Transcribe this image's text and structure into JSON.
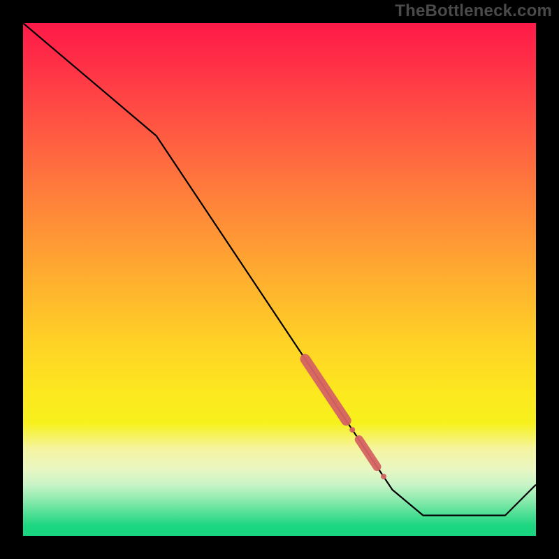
{
  "watermark": "TheBottleneck.com",
  "chart_data": {
    "type": "line",
    "title": "",
    "xlabel": "",
    "ylabel": "",
    "xlim": [
      0,
      100
    ],
    "ylim": [
      0,
      100
    ],
    "grid": false,
    "legend": false,
    "series": [
      {
        "name": "curve",
        "x": [
          0,
          26,
          72,
          78,
          94,
          100
        ],
        "y": [
          100,
          78,
          9,
          4,
          4,
          10
        ]
      }
    ],
    "markers": [
      {
        "name": "highlight-segment-upper",
        "shape": "thick-segment",
        "x0": 55,
        "y0": 34.5,
        "x1": 63,
        "y1": 22.5,
        "radius": 1.8
      },
      {
        "name": "highlight-dot-mid",
        "shape": "dot",
        "x": 64.2,
        "y": 20.7,
        "radius": 1.0
      },
      {
        "name": "highlight-segment-mid",
        "shape": "thick-segment",
        "x0": 65.5,
        "y0": 18.8,
        "x1": 69.0,
        "y1": 13.5,
        "radius": 1.5
      },
      {
        "name": "highlight-dot-lower",
        "shape": "dot",
        "x": 70.3,
        "y": 11.6,
        "radius": 1.0
      }
    ],
    "colors": {
      "line": "#000000",
      "marker": "#d56262",
      "gradient_top": "#ff1a49",
      "gradient_mid": "#ffd126",
      "gradient_bottom": "#17d47e",
      "frame": "#000000"
    }
  }
}
